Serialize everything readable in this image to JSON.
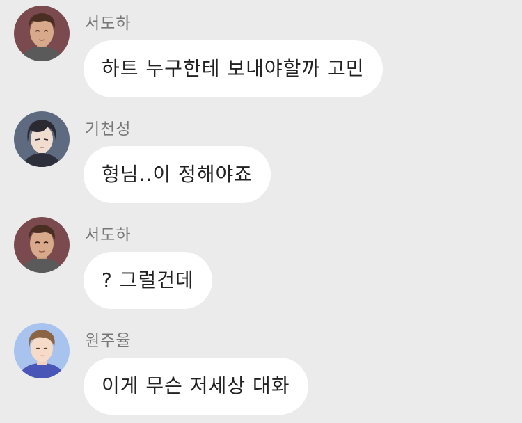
{
  "chat": {
    "messages": [
      {
        "sender": "서도하",
        "avatar_icon": "man-brown-hair-avatar-icon",
        "text": "하트 누구한테 보내야할까 고민"
      },
      {
        "sender": "기천성",
        "avatar_icon": "man-black-hair-avatar-icon",
        "text": "형님..이 정해야죠"
      },
      {
        "sender": "서도하",
        "avatar_icon": "man-brown-hair-avatar-icon",
        "text": "? 그럴건데"
      },
      {
        "sender": "원주율",
        "avatar_icon": "man-light-hair-blue-avatar-icon",
        "text": "이게 무슨 저세상 대화"
      }
    ]
  },
  "colors": {
    "background": "#ebebeb",
    "bubble": "#ffffff",
    "sender_text": "#777777",
    "message_text": "#222222"
  }
}
